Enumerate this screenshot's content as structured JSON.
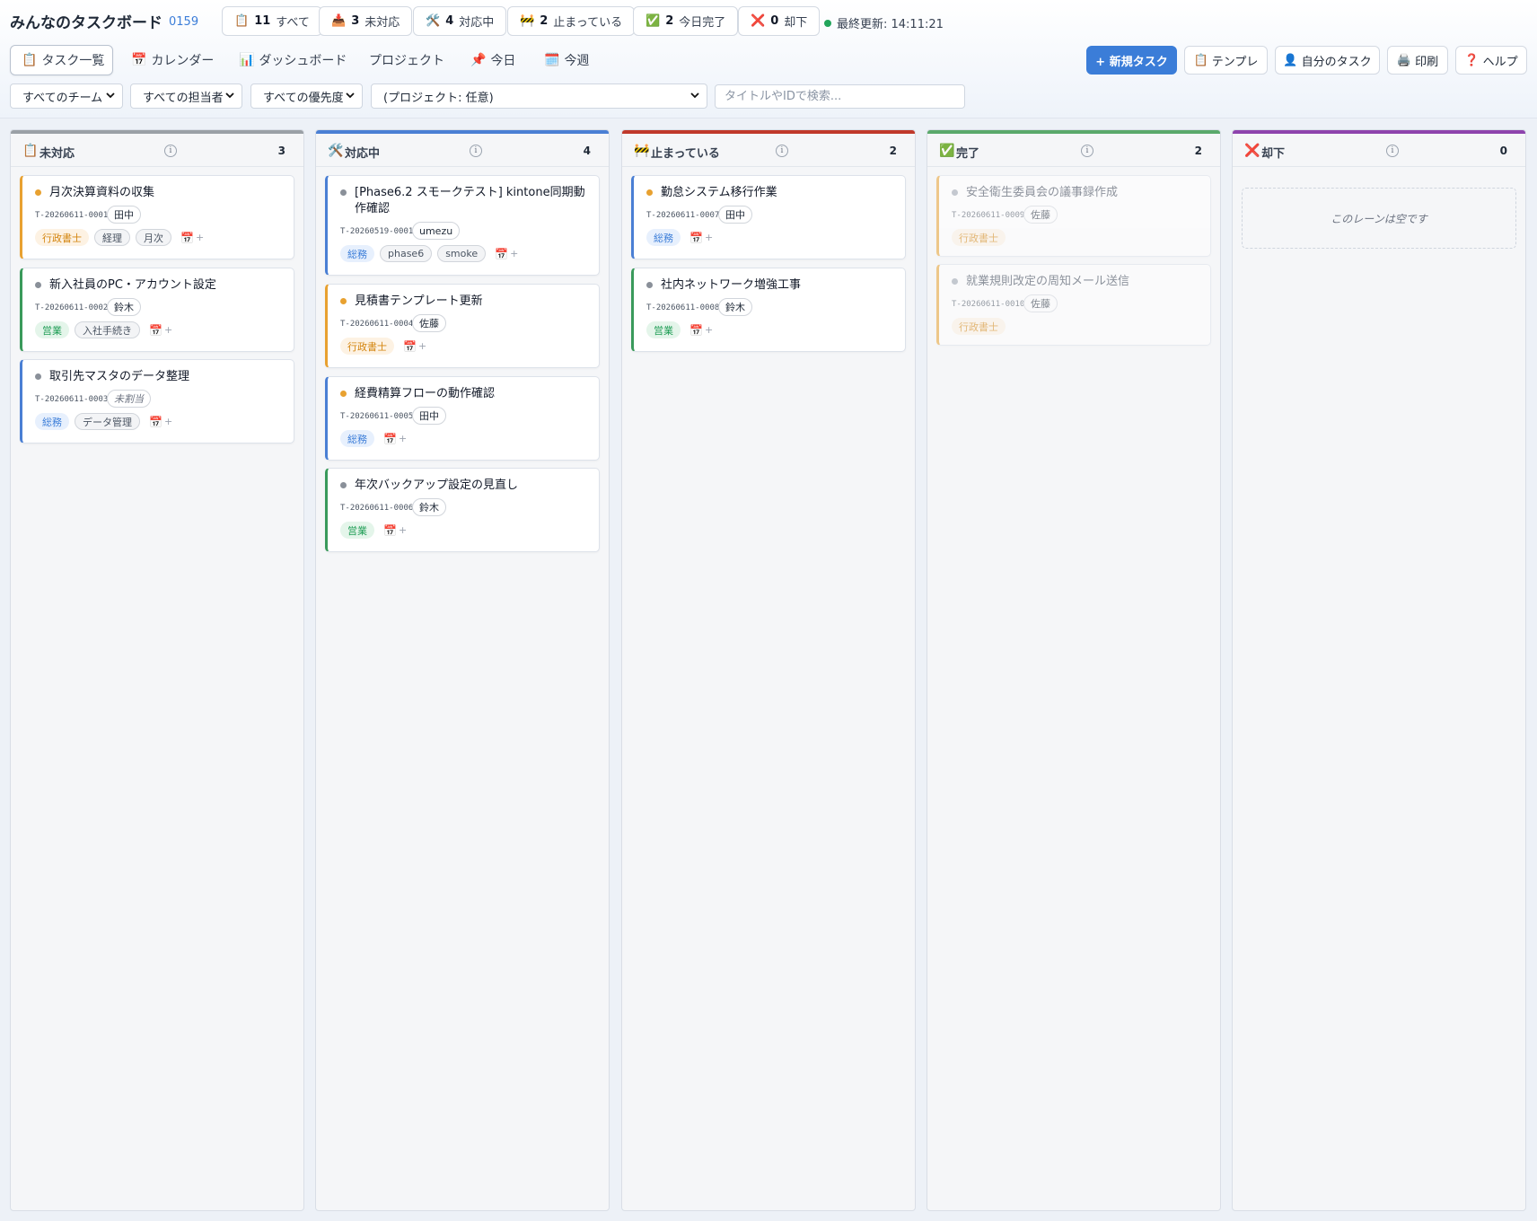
{
  "app": {
    "title": "みんなのタスクボード",
    "build": "0159"
  },
  "stats": [
    {
      "icon": "📋",
      "count": "11",
      "label": "すべて",
      "active": true
    },
    {
      "icon": "📥",
      "count": "3",
      "label": "未対応"
    },
    {
      "icon": "🛠️",
      "count": "4",
      "label": "対応中"
    },
    {
      "icon": "🚧",
      "count": "2",
      "label": "止まっている"
    },
    {
      "icon": "✅",
      "count": "2",
      "label": "今日完了"
    },
    {
      "icon": "❌",
      "count": "0",
      "label": "却下"
    }
  ],
  "last_updated": "最終更新: 14:11:21",
  "nav": [
    {
      "icon": "📋",
      "label": "タスク一覧",
      "active": true
    },
    {
      "icon": "📅",
      "label": "カレンダー"
    },
    {
      "icon": "📊",
      "label": "ダッシュボード"
    },
    {
      "icon": "",
      "label": "プロジェクト"
    },
    {
      "icon": "📌",
      "label": "今日"
    },
    {
      "icon": "🗓️",
      "label": "今週"
    }
  ],
  "actions": {
    "new_task": "+ 新規タスク",
    "template": {
      "icon": "📋",
      "label": "テンプレ"
    },
    "my_tasks": {
      "icon": "👤",
      "label": "自分のタスク"
    },
    "print": {
      "icon": "🖨️",
      "label": "印刷"
    },
    "help": {
      "icon": "❓",
      "label": "ヘルプ"
    }
  },
  "filters": {
    "team": "すべてのチーム",
    "assignee": "すべての担当者",
    "priority": "すべての優先度",
    "project": "(プロジェクト: 任意)",
    "search_placeholder": "タイトルやIDで検索..."
  },
  "colors": {
    "accent": "#3b7dd8",
    "lane_todo": "#9aa0a6",
    "lane_doing": "#4a7fd4",
    "lane_blocked": "#c0392b",
    "lane_done": "#5aa96b",
    "lane_rejected": "#8e44ad",
    "priority_high": "#e8a130",
    "priority_normal": "#8a9099",
    "category_orange": "#e8a130",
    "category_green": "#3a9a5b",
    "category_blue": "#4a7fd4"
  },
  "lanes": [
    {
      "icon": "📋",
      "title": "未対応",
      "count": "3",
      "cards": [
        {
          "title": "月次決算資料の収集",
          "id": "T-20260611-0001",
          "assignee": "田中",
          "priority": "high",
          "category": "orange",
          "tags": [
            {
              "text": "行政書士",
              "kind": "cat-orange"
            },
            {
              "text": "経理",
              "kind": "plain"
            },
            {
              "text": "月次",
              "kind": "plain"
            }
          ]
        },
        {
          "title": "新入社員のPC・アカウント設定",
          "id": "T-20260611-0002",
          "assignee": "鈴木",
          "priority": "normal",
          "category": "green",
          "tags": [
            {
              "text": "営業",
              "kind": "cat-green"
            },
            {
              "text": "入社手続き",
              "kind": "plain"
            }
          ]
        },
        {
          "title": "取引先マスタのデータ整理",
          "id": "T-20260611-0003",
          "assignee": "未割当",
          "unassigned": true,
          "priority": "normal",
          "category": "blue",
          "tags": [
            {
              "text": "総務",
              "kind": "cat-blue"
            },
            {
              "text": "データ管理",
              "kind": "plain"
            }
          ]
        }
      ]
    },
    {
      "icon": "🛠️",
      "title": "対応中",
      "count": "4",
      "cards": [
        {
          "title": "[Phase6.2 スモークテスト] kintone同期動作確認",
          "id": "T-20260519-0001",
          "assignee": "umezu",
          "priority": "normal",
          "category": "blue",
          "two_line": true,
          "tags": [
            {
              "text": "総務",
              "kind": "cat-blue"
            },
            {
              "text": "phase6",
              "kind": "plain"
            },
            {
              "text": "smoke",
              "kind": "plain"
            }
          ]
        },
        {
          "title": "見積書テンプレート更新",
          "id": "T-20260611-0004",
          "assignee": "佐藤",
          "priority": "high",
          "category": "orange",
          "tags": [
            {
              "text": "行政書士",
              "kind": "cat-orange"
            }
          ]
        },
        {
          "title": "経費精算フローの動作確認",
          "id": "T-20260611-0005",
          "assignee": "田中",
          "priority": "high",
          "category": "blue",
          "tags": [
            {
              "text": "総務",
              "kind": "cat-blue"
            }
          ]
        },
        {
          "title": "年次バックアップ設定の見直し",
          "id": "T-20260611-0006",
          "assignee": "鈴木",
          "priority": "normal",
          "category": "green",
          "tags": [
            {
              "text": "営業",
              "kind": "cat-green"
            }
          ]
        }
      ]
    },
    {
      "icon": "🚧",
      "title": "止まっている",
      "count": "2",
      "cards": [
        {
          "title": "勤怠システム移行作業",
          "id": "T-20260611-0007",
          "assignee": "田中",
          "priority": "high",
          "category": "blue",
          "tags": [
            {
              "text": "総務",
              "kind": "cat-blue"
            }
          ]
        },
        {
          "title": "社内ネットワーク増強工事",
          "id": "T-20260611-0008",
          "assignee": "鈴木",
          "priority": "normal",
          "category": "green",
          "tags": [
            {
              "text": "営業",
              "kind": "cat-green"
            }
          ]
        }
      ]
    },
    {
      "icon": "✅",
      "title": "完了",
      "count": "2",
      "cards": [
        {
          "title": "安全衛生委員会の議事録作成",
          "id": "T-20260611-0009",
          "assignee": "佐藤",
          "priority": "done",
          "category": "orange",
          "done": true,
          "tags": [
            {
              "text": "行政書士",
              "kind": "cat-orange"
            }
          ]
        },
        {
          "title": "就業規則改定の周知メール送信",
          "id": "T-20260611-0010",
          "assignee": "佐藤",
          "priority": "done",
          "category": "orange",
          "done": true,
          "tags": [
            {
              "text": "行政書士",
              "kind": "cat-orange"
            }
          ]
        }
      ]
    },
    {
      "icon": "❌",
      "title": "却下",
      "count": "0",
      "empty_text": "このレーンは空です",
      "cards": []
    }
  ]
}
